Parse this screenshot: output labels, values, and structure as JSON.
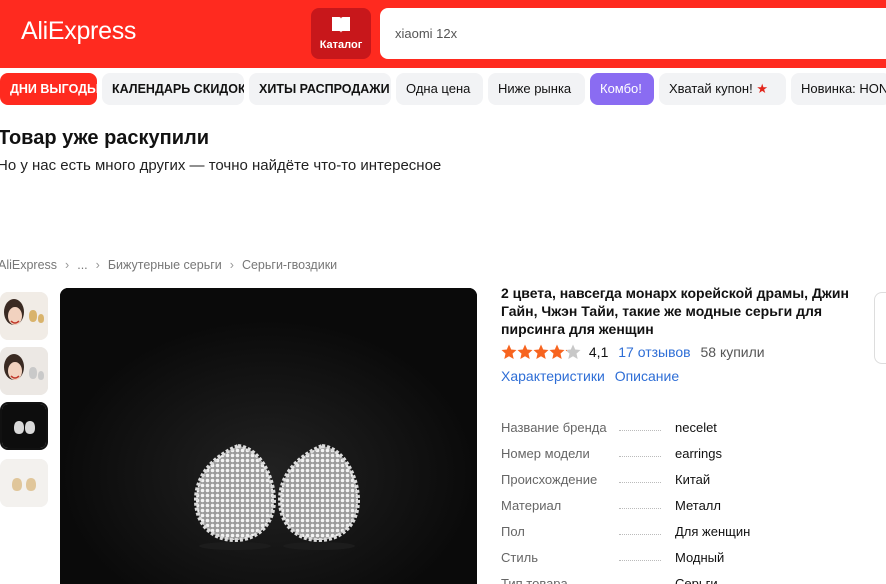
{
  "header": {
    "logo": "AliExpress",
    "catalog_label": "Каталог",
    "search_value": "xiaomi 12x"
  },
  "nav": {
    "items": [
      "ДНИ ВЫГОДЫ",
      "КАЛЕНДАРЬ СКИДОК",
      "ХИТЫ РАСПРОДАЖИ",
      "Одна цена",
      "Ниже рынка",
      "Комбо!",
      "Хватай купон!",
      "Новинка: HON"
    ],
    "coupon_star": "★"
  },
  "notice": {
    "title": "Товар уже раскупили",
    "subtitle": "Но у нас есть много других — точно найдёте что-то интересное"
  },
  "breadcrumb": {
    "items": [
      "AliExpress",
      "...",
      "Бижутерные серьги",
      "Серьги-гвоздики"
    ],
    "separator": "›"
  },
  "product": {
    "title": "2 цвета, навсегда монарх корейской драмы, Джин Гайн, Чжэн Тайи, такие же модные серьги для пирсинга для женщин",
    "rating": "4,1",
    "rating_value": 4.1,
    "reviews": "17 отзывов",
    "sold": "58 купили",
    "tabs": [
      "Характеристики",
      "Описание"
    ],
    "specs": [
      {
        "key": "Название бренда",
        "value": "necelet"
      },
      {
        "key": "Номер модели",
        "value": "earrings"
      },
      {
        "key": "Происхождение",
        "value": "Китай"
      },
      {
        "key": "Материал",
        "value": "Металл"
      },
      {
        "key": "Пол",
        "value": "Для женщин"
      },
      {
        "key": "Стиль",
        "value": "Модный"
      },
      {
        "key": "Тип товара",
        "value": "Серьги"
      }
    ]
  },
  "colors": {
    "brand_red": "#ff2a1f",
    "catalog_red": "#c8171b",
    "combo_purple": "#8a6cf2",
    "link_blue": "#2e6ed6",
    "star_orange": "#f7641f"
  }
}
